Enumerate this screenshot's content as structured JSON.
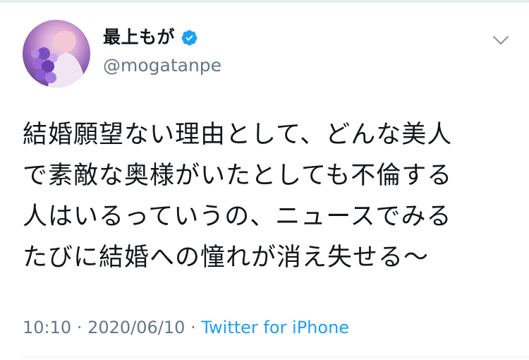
{
  "author": {
    "display_name": "最上もが",
    "handle": "@mogatanpe",
    "verified": true,
    "avatar_icon": "profile-photo"
  },
  "tweet": {
    "lines": [
      "結婚願望ない理由として、どんな美人",
      "で素敵な奥様がいたとしても不倫する",
      "人はいるっていうの、ニュースでみる",
      "たびに結婚への憧れが消え失せる〜"
    ]
  },
  "meta": {
    "time": "10:10",
    "separator": "·",
    "date": "2020/06/10",
    "source": "Twitter for iPhone"
  },
  "icons": {
    "menu": "chevron-down-icon",
    "verified": "verified-badge-icon"
  },
  "colors": {
    "link": "#1da1f2",
    "secondary_text": "#657786",
    "verified": "#1da1f2"
  }
}
